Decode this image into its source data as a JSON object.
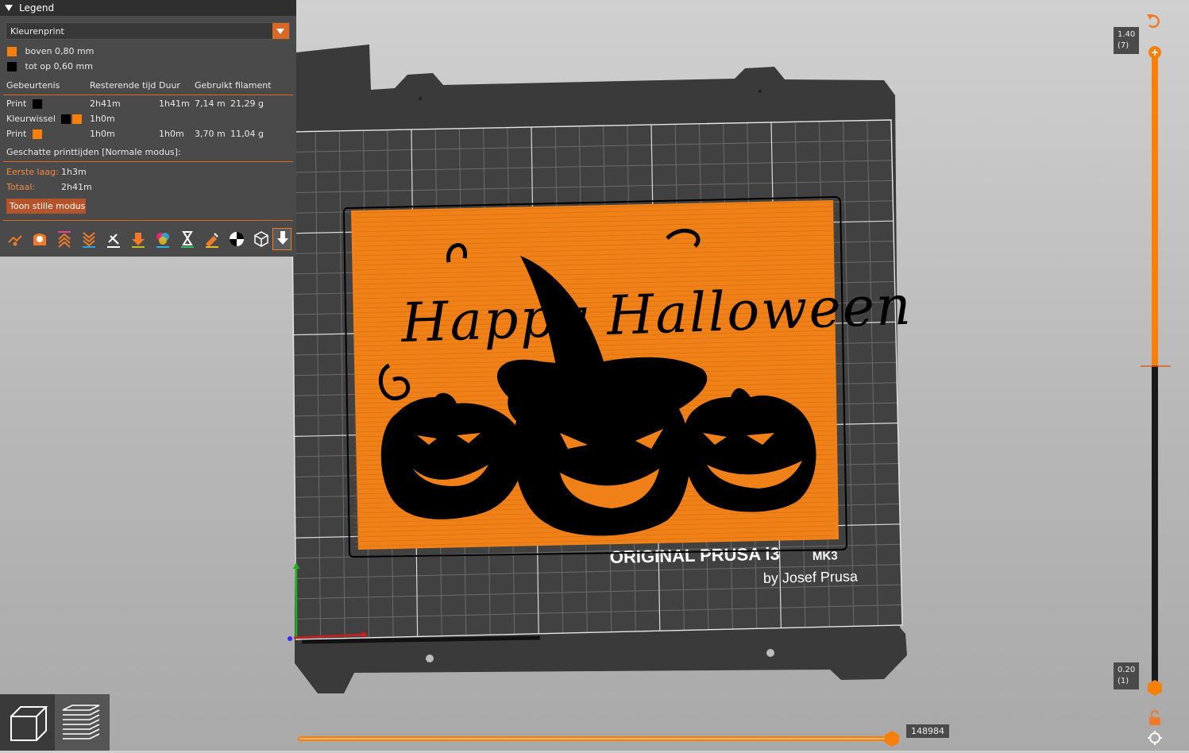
{
  "legend": {
    "title": "Legend",
    "view_type": "Kleurenprint",
    "ranges": [
      {
        "label": "boven 0,80 mm",
        "color": "#f7800b"
      },
      {
        "label": "tot op 0,60 mm",
        "color": "#000000"
      }
    ],
    "headers": {
      "event": "Gebeurtenis",
      "remaining": "Resterende tijd",
      "duration": "Duur",
      "filament": "Gebruikt filament"
    },
    "rows": [
      {
        "event": "Print",
        "remaining": "2h41m",
        "duration": "1h41m",
        "length": "7,14 m",
        "weight": "21,29 g"
      },
      {
        "event": "Kleurwissel",
        "remaining": "1h0m",
        "duration": "",
        "length": "",
        "weight": ""
      },
      {
        "event": "Print",
        "remaining": "1h0m",
        "duration": "1h0m",
        "length": "3,70 m",
        "weight": "11,04 g"
      }
    ],
    "estimated_title": "Geschatte printtijden [Normale modus]:",
    "first_layer_label": "Eerste laag:",
    "first_layer_value": "1h3m",
    "total_label": "Totaal:",
    "total_value": "2h41m",
    "quiet_button": "Toon stille modus",
    "tool_icons": [
      "travel-icon",
      "wipe-icon",
      "retractions-icon",
      "deretractions-icon",
      "seams-icon",
      "tool-changes-icon",
      "color-changes-icon",
      "pause-prints-icon",
      "custom-gcodes-icon",
      "center-of-gravity-icon",
      "shells-icon",
      "tool-marker-icon"
    ]
  },
  "vertical_slider": {
    "top_value": "1.40",
    "top_layer": "(7)",
    "bottom_value": "0.20",
    "bottom_layer": "(1)",
    "icons": [
      "undo-arrow-icon",
      "lock-icon",
      "settings-cog-icon"
    ],
    "accent": "#f7800b"
  },
  "horizontal_slider": {
    "value": "148984",
    "progress": 1.0
  },
  "bed": {
    "brand_line1": "ORIGINAL PRUSA i3",
    "brand_mk": "MK3",
    "brand_line2": "by Josef Prusa"
  },
  "model": {
    "text": "Happy Halloween"
  },
  "view_buttons": [
    "3d-view-icon",
    "preview-layers-icon"
  ]
}
